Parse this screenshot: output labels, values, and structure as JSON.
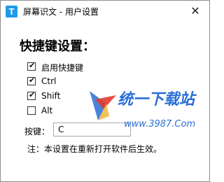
{
  "window": {
    "title": "屏幕识文 - 用户设置",
    "close_glyph": "✕",
    "app_icon_letter": "T"
  },
  "settings": {
    "heading": "快捷键设置：",
    "checkboxes": [
      {
        "label": "启用快捷键",
        "checked": true
      },
      {
        "label": "Ctrl",
        "checked": true
      },
      {
        "label": "Shift",
        "checked": true
      },
      {
        "label": "Alt",
        "checked": false
      }
    ],
    "hotkey_label": "按键：",
    "hotkey_value": "C",
    "note": "注：本设置在重新打开软件后生效。"
  },
  "watermark": {
    "text": "统一下载站",
    "url": "www.3987.Com"
  },
  "colors": {
    "app_icon": "#1e9be8",
    "watermark_blue": "#2a6fd6",
    "watermark_red": "#e23a2e"
  },
  "check_glyph": "✔"
}
